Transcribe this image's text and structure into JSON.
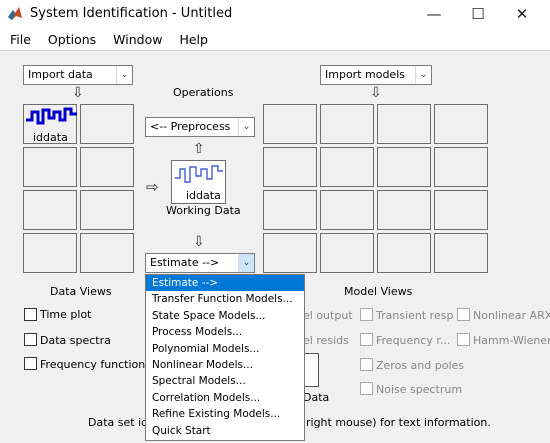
{
  "window": {
    "title": "System Identification - Untitled",
    "controls": {
      "minimize": "—",
      "maximize": "☐",
      "close": "✕"
    }
  },
  "menu": [
    "File",
    "Options",
    "Window",
    "Help"
  ],
  "left": {
    "import_data": "Import data",
    "data_icon_label": "iddata",
    "data_views_title": "Data Views",
    "checkboxes": [
      "Time plot",
      "Data spectra",
      "Frequency function"
    ]
  },
  "center": {
    "operations_label": "Operations",
    "preprocess": "<-- Preprocess",
    "working_data_icon_label": "iddata",
    "working_data_label": "Working Data",
    "estimate": "Estimate -->"
  },
  "right": {
    "import_models": "Import models",
    "model_views_title": "Model Views",
    "checkboxes": [
      "el output",
      "Transient resp",
      "Nonlinear ARX",
      "el resids",
      "Frequency r...",
      "Hamm-Wiener",
      "Zeros and poles",
      "Noise spectrum"
    ],
    "partial_label": "Data"
  },
  "status": {
    "left": "Data set idda",
    "right": "right mouse) for text information."
  },
  "estimate_menu": [
    "Estimate -->",
    "Transfer Function Models...",
    "State Space Models...",
    "Process Models...",
    "Polynomial Models...",
    "Nonlinear Models...",
    "Spectral Models...",
    "Correlation Models...",
    "Refine Existing Models...",
    "Quick Start"
  ],
  "colors": {
    "signal": "#0000cc",
    "selection": "#0078d7",
    "panel": "#f0f0f0"
  }
}
